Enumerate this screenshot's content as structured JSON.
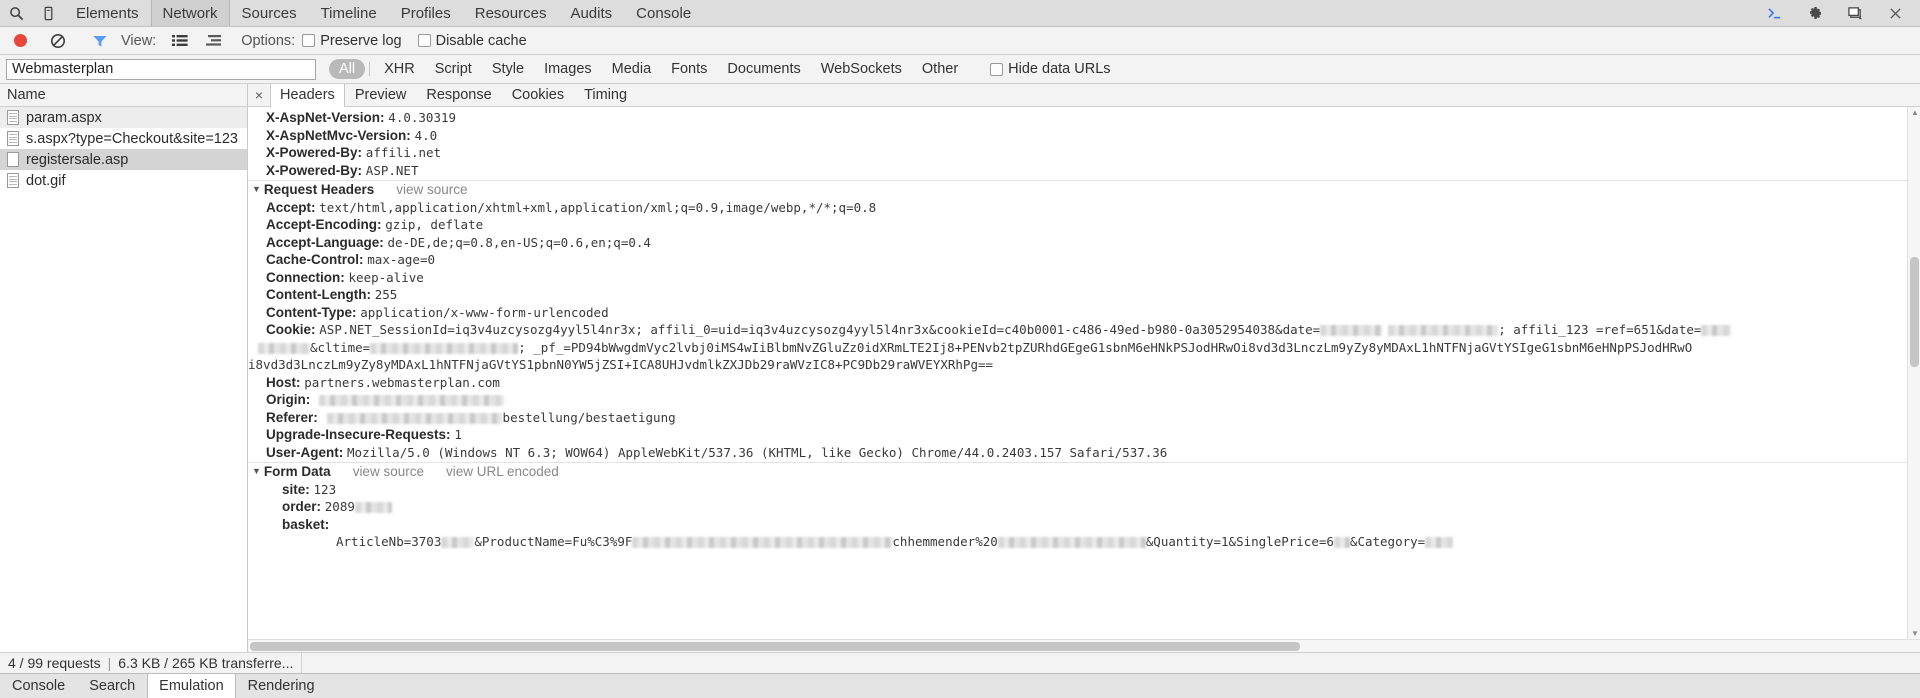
{
  "window": {
    "top_toolbar": {
      "search_icon": "search-icon",
      "device_icon": "device-toggle-icon",
      "panels": [
        {
          "label": "Elements",
          "selected": false
        },
        {
          "label": "Network",
          "selected": true
        },
        {
          "label": "Sources",
          "selected": false
        },
        {
          "label": "Timeline",
          "selected": false
        },
        {
          "label": "Profiles",
          "selected": false
        },
        {
          "label": "Resources",
          "selected": false
        },
        {
          "label": "Audits",
          "selected": false
        },
        {
          "label": "Console",
          "selected": false
        }
      ],
      "right_icons": [
        "console-drawer-icon",
        "gear-icon",
        "dock-side-icon",
        "close-icon"
      ]
    }
  },
  "network_toolbar": {
    "record_label": "record-button",
    "clear_label": "clear-button",
    "filter_label": "filter-button",
    "view_label": "View:",
    "view_list_icon": "list-view-icon",
    "view_timeline_icon": "timeline-view-icon",
    "options_label": "Options:",
    "preserve_log": "Preserve log",
    "disable_cache": "Disable cache"
  },
  "filter_bar": {
    "input_value": "Webmasterplan",
    "input_placeholder": "Filter",
    "types": [
      {
        "label": "All",
        "active": true
      },
      {
        "label": "XHR",
        "active": false
      },
      {
        "label": "Script",
        "active": false
      },
      {
        "label": "Style",
        "active": false
      },
      {
        "label": "Images",
        "active": false
      },
      {
        "label": "Media",
        "active": false
      },
      {
        "label": "Fonts",
        "active": false
      },
      {
        "label": "Documents",
        "active": false
      },
      {
        "label": "WebSockets",
        "active": false
      },
      {
        "label": "Other",
        "active": false
      }
    ],
    "hide_data_urls": "Hide data URLs"
  },
  "request_list": {
    "column_header": "Name",
    "rows": [
      {
        "name": "param.aspx",
        "style": "alt",
        "icon": "document-icon"
      },
      {
        "name": "s.aspx?type=Checkout&site=123",
        "style": "plain",
        "icon": "document-icon"
      },
      {
        "name": "registersale.asp",
        "style": "sel",
        "icon": "blank-document-icon"
      },
      {
        "name": "dot.gif",
        "style": "plain",
        "icon": "document-icon"
      }
    ]
  },
  "detail": {
    "close_icon": "×",
    "tabs": [
      {
        "label": "Headers",
        "selected": true
      },
      {
        "label": "Preview",
        "selected": false
      },
      {
        "label": "Response",
        "selected": false
      },
      {
        "label": "Cookies",
        "selected": false
      },
      {
        "label": "Timing",
        "selected": false
      }
    ],
    "response_headers_tail": [
      {
        "name": "X-AspNet-Version:",
        "value": "4.0.30319"
      },
      {
        "name": "X-AspNetMvc-Version:",
        "value": "4.0"
      },
      {
        "name": "X-Powered-By:",
        "value": "affili.net"
      },
      {
        "name": "X-Powered-By:",
        "value": "ASP.NET"
      }
    ],
    "request_headers": {
      "title": "Request Headers",
      "view_source": "view source",
      "items": [
        {
          "name": "Accept:",
          "value": "text/html,application/xhtml+xml,application/xml;q=0.9,image/webp,*/*;q=0.8"
        },
        {
          "name": "Accept-Encoding:",
          "value": "gzip, deflate"
        },
        {
          "name": "Accept-Language:",
          "value": "de-DE,de;q=0.8,en-US;q=0.6,en;q=0.4"
        },
        {
          "name": "Cache-Control:",
          "value": "max-age=0"
        },
        {
          "name": "Connection:",
          "value": "keep-alive"
        },
        {
          "name": "Content-Length:",
          "value": "255"
        },
        {
          "name": "Content-Type:",
          "value": "application/x-www-form-urlencoded"
        }
      ],
      "cookie": {
        "name": "Cookie:",
        "line1_a": "ASP.NET_SessionId=iq3v4uzcysozg4yyl5l4nr3x; affili_0=uid=iq3v4uzcysozg4yyl5l4nr3x&cookieId=c40b0001-c486-49ed-b980-0a3052954038&date=",
        "line1_b": "; affili_123  =ref=651&date=",
        "line2_a": "&cltime=",
        "line2_b": "; _pf_=PD94bWwgdmVyc2lvbj0iMS4wIiBlbmNvZGluZz0idXRmLTE2Ij8+PENvb2tpZURhdGEgeG1sbnM6eHNkPSJodHRwOi8vd3d3LnczLm9yZy8yMDAxL1hNTFNjaGVtYSIgeG1sbnM6eHNpPSJodHRwO",
        "line3": "i8vd3d3LnczLm9yZy8yMDAxL1hNTFNjaGVtYS1pbnN0YW5jZSI+ICA8UHJvdmlkZXJDb29raWVzIC8+PC9Db29raWVEYXRhPg=="
      },
      "items_tail": [
        {
          "name": "Host:",
          "value": "partners.webmasterplan.com"
        },
        {
          "name": "Origin:",
          "value": "",
          "redacted_width": 185
        },
        {
          "name": "Referer:",
          "value": "bestellung/bestaetigung",
          "redacted_width": 175
        },
        {
          "name": "Upgrade-Insecure-Requests:",
          "value": "1"
        },
        {
          "name": "User-Agent:",
          "value": "Mozilla/5.0 (Windows NT 6.3; WOW64) AppleWebKit/537.36 (KHTML, like Gecko) Chrome/44.0.2403.157 Safari/537.36"
        }
      ]
    },
    "form_data": {
      "title": "Form Data",
      "view_source": "view source",
      "view_url_encoded": "view URL encoded",
      "items": [
        {
          "name": "site:",
          "value": "123"
        },
        {
          "name": "order:",
          "value": "2089"
        },
        {
          "name": "basket:",
          "value": ""
        }
      ],
      "basket_line": {
        "a": "ArticleNb=3703",
        "b": "&ProductName=Fu%C3%9F",
        "c": "chhemmender%20",
        "d": "&Quantity=1&SinglePrice=6",
        "e": "&Category="
      }
    }
  },
  "status_bar": {
    "requests": "4 / 99 requests",
    "separator": "|",
    "transferred": "6.3 KB / 265 KB transferre..."
  },
  "drawer": {
    "tabs": [
      {
        "label": "Console",
        "selected": false
      },
      {
        "label": "Search",
        "selected": false
      },
      {
        "label": "Emulation",
        "selected": true
      },
      {
        "label": "Rendering",
        "selected": false
      }
    ]
  }
}
